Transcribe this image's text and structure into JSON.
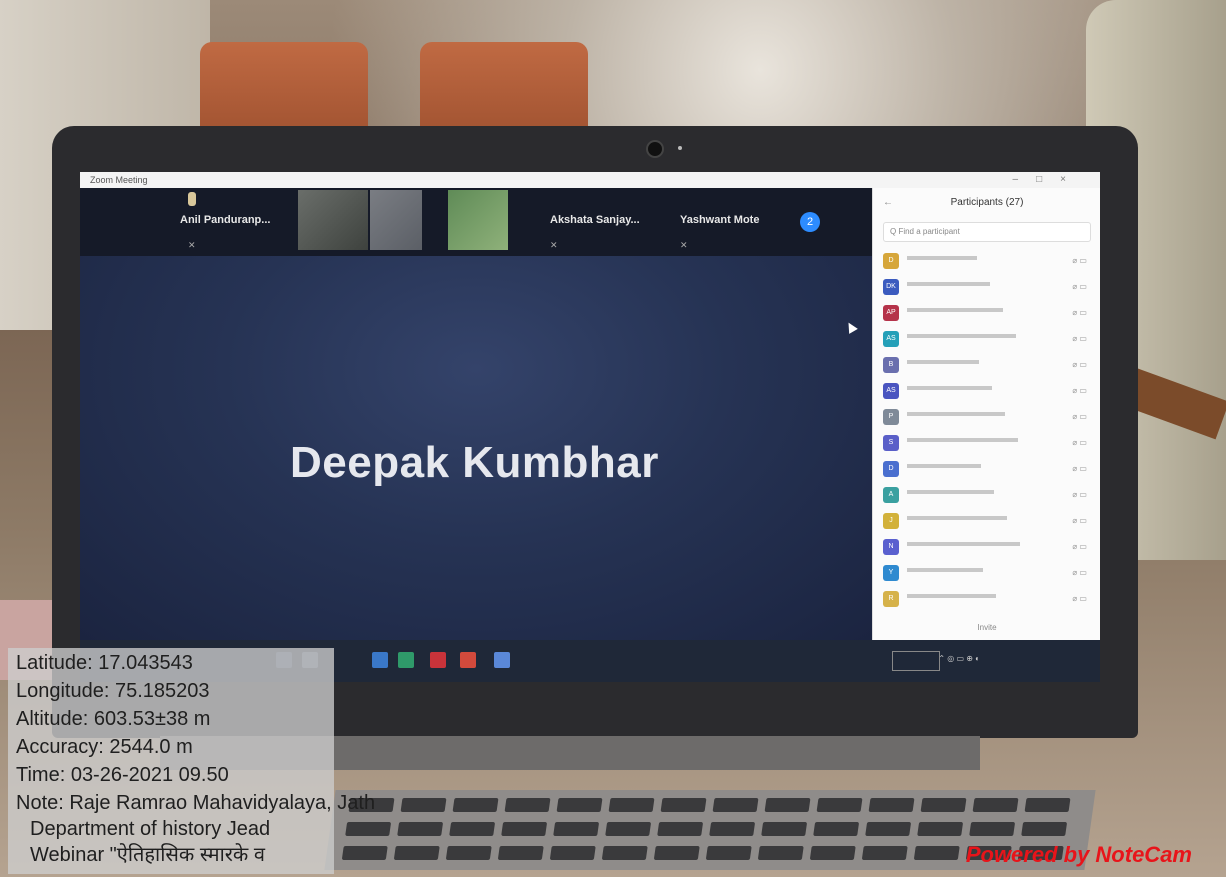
{
  "zoom": {
    "window_title": "Zoom Meeting",
    "gallery": [
      {
        "name": "Anil Panduranp..."
      },
      {
        "name": "Akshata Sanjay..."
      },
      {
        "name": "Yashwant Mote"
      }
    ],
    "gallery_count": "2",
    "speaker_name": "Deepak Kumbhar",
    "participants_panel": {
      "title": "Participants (27)",
      "search_placeholder": "Q  Find a participant",
      "participants": [
        {
          "initials": "D"
        },
        {
          "initials": "DK"
        },
        {
          "initials": "AP"
        },
        {
          "initials": "AS"
        },
        {
          "initials": "B"
        },
        {
          "initials": "AS"
        },
        {
          "initials": "P"
        },
        {
          "initials": "S"
        },
        {
          "initials": "D"
        },
        {
          "initials": "A"
        },
        {
          "initials": "J"
        },
        {
          "initials": "N"
        },
        {
          "initials": "Y"
        },
        {
          "initials": "R"
        }
      ],
      "footer": "Invite"
    }
  },
  "notecam": {
    "latitude": "Latitude: 17.043543",
    "longitude": "Longitude: 75.185203",
    "altitude": "Altitude: 603.53±38 m",
    "accuracy": "Accuracy: 2544.0 m",
    "time": "Time: 03-26-2021 09.50",
    "note": "Note: Raje Ramrao Mahavidyalaya, Jath",
    "department": "Department of history Jead",
    "webinar": "Webinar \"ऐतिहासिक स्मारके व",
    "brand": "Powered by NoteCam",
    "brand_color": "#e8141a"
  }
}
